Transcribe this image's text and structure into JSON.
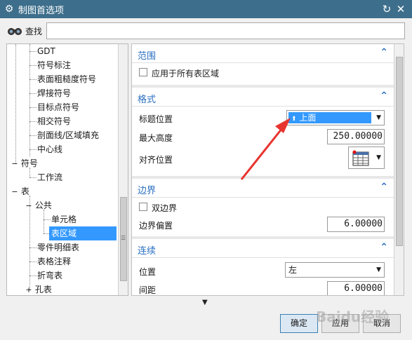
{
  "window": {
    "title": "制图首选项"
  },
  "search": {
    "label": "查找",
    "value": ""
  },
  "tree": {
    "items": [
      {
        "label": "GDT"
      },
      {
        "label": "符号标注"
      },
      {
        "label": "表面粗糙度符号"
      },
      {
        "label": "焊接符号"
      },
      {
        "label": "目标点符号"
      },
      {
        "label": "相交符号"
      },
      {
        "label": "剖面线/区域填充"
      },
      {
        "label": "中心线"
      },
      {
        "label": "符号"
      },
      {
        "label": "工作流"
      },
      {
        "label": "表"
      },
      {
        "label": "公共"
      },
      {
        "label": "单元格"
      },
      {
        "label": "表区域"
      },
      {
        "label": "零件明细表"
      },
      {
        "label": "表格注释"
      },
      {
        "label": "折弯表"
      },
      {
        "label": "孔表"
      }
    ]
  },
  "sections": {
    "range": {
      "title": "范围",
      "apply_all": "应用于所有表区域"
    },
    "format": {
      "title": "格式",
      "title_pos_label": "标题位置",
      "title_pos_value": "上面",
      "max_height_label": "最大高度",
      "max_height_value": "250.00000",
      "align_label": "对齐位置"
    },
    "border": {
      "title": "边界",
      "double_border": "双边界",
      "offset_label": "边界偏置",
      "offset_value": "6.00000"
    },
    "continue": {
      "title": "连续",
      "pos_label": "位置",
      "pos_value": "左",
      "spacing_label": "间距",
      "spacing_value": "6.00000"
    }
  },
  "buttons": {
    "ok": "确定",
    "apply": "应用",
    "cancel": "取消"
  },
  "watermark": "Baidu经验",
  "colors": {
    "titlebar": "#3d6f8c",
    "accent": "#2a6fc0",
    "selection": "#3399ff",
    "annotation_arrow": "#e8342f"
  }
}
